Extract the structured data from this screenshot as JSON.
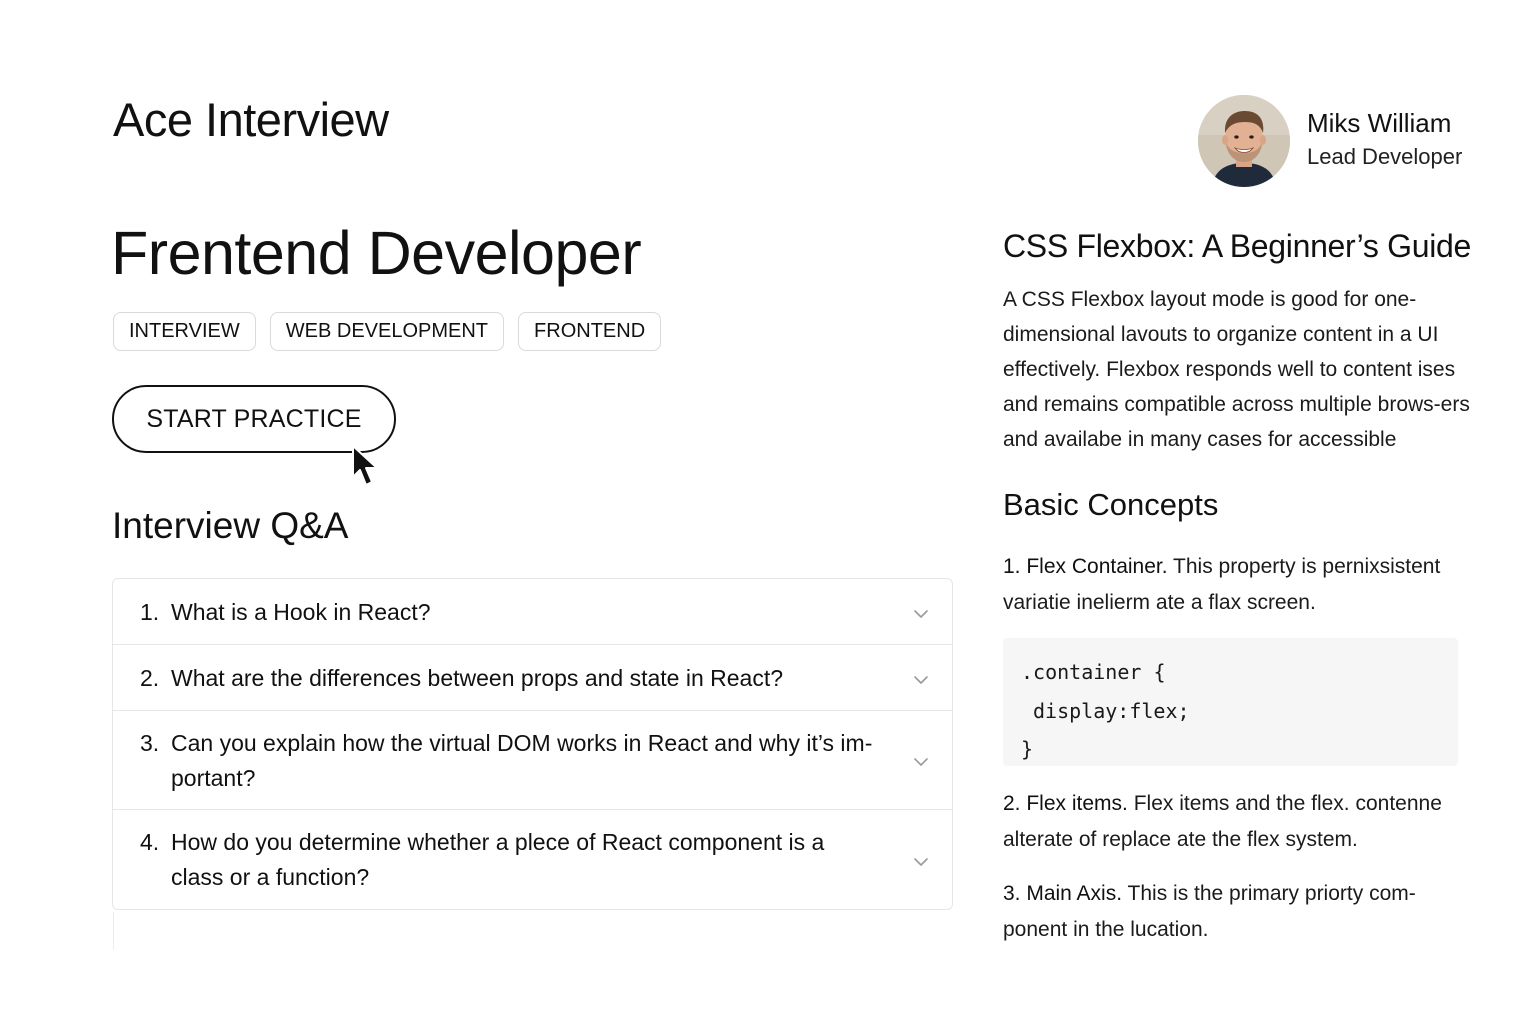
{
  "app": {
    "title": "Ace Interview"
  },
  "page": {
    "title": "Frentend Developer",
    "tags": [
      "INTERVIEW",
      "WEB DEVELOPMENT",
      "FRONTEND"
    ],
    "start_button_label": "START PRACTICE"
  },
  "qa": {
    "heading": "Interview Q&A",
    "items": [
      {
        "number": "1.",
        "question": "What is a Hook in React?"
      },
      {
        "number": "2.",
        "question": "What are the differences between props and state in React?"
      },
      {
        "number": "3.",
        "question": "Can you explain how the virtual DOM works in React and why it’s im-portant?"
      },
      {
        "number": "4.",
        "question": "How do you determine whether a plece of React component is a class or a function?"
      }
    ]
  },
  "profile": {
    "name": "Miks William",
    "role": "Lead Developer"
  },
  "article": {
    "title": "CSS Flexbox: A Beginner’s Guide",
    "intro": "A CSS Flexbox layout mode is good for one-dimensional lavouts to organize content in a UI effectively. Flexbox responds well to content ises and remains compatible across multiple brows-ers and availabe in many cases for accessible",
    "section_heading": "Basic Concepts",
    "concepts": [
      {
        "term": "1. Flex Container.",
        "text": " This property is pernixsistent variatie inelierm ate a flax screen."
      },
      {
        "term": "2. Flex items.",
        "text": " Flex items and the flex. contenne alterate of replace ate the flex system."
      },
      {
        "term": "3. Main Axis.",
        "text": " This is the primary priorty com-ponent in the lucation."
      }
    ],
    "code": {
      "line1": ".container {",
      "line2": "display:flex;",
      "line3": "}"
    }
  },
  "colors": {
    "text": "#111111",
    "border": "#e6e6e6",
    "code_background": "#f6f6f6"
  }
}
